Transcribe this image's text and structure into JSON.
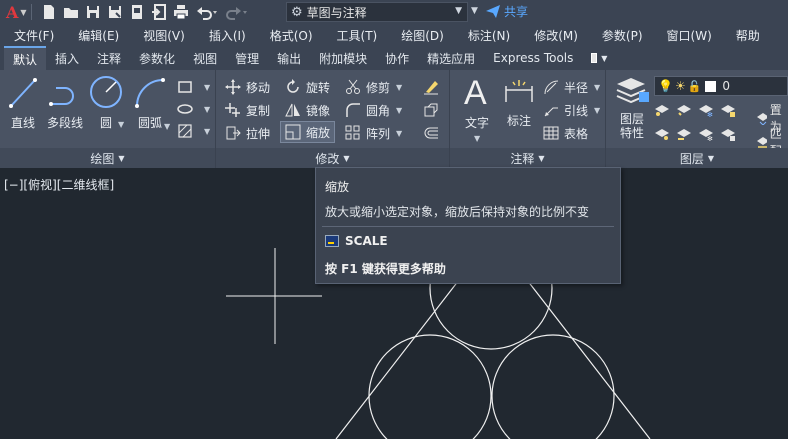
{
  "qbar": {
    "app_logo": "A",
    "workspace": "草图与注释",
    "share": "共享"
  },
  "menu": [
    "文件(F)",
    "编辑(E)",
    "视图(V)",
    "插入(I)",
    "格式(O)",
    "工具(T)",
    "绘图(D)",
    "标注(N)",
    "修改(M)",
    "参数(P)",
    "窗口(W)",
    "帮助"
  ],
  "tabs": [
    "默认",
    "插入",
    "注释",
    "参数化",
    "视图",
    "管理",
    "输出",
    "附加模块",
    "协作",
    "精选应用",
    "Express Tools"
  ],
  "active_tab": "默认",
  "draw_panel": {
    "title": "绘图",
    "line": "直线",
    "polyline": "多段线",
    "circle": "圆",
    "arc": "圆弧"
  },
  "modify_panel": {
    "title": "修改",
    "move": "移动",
    "rotate": "旋转",
    "trim": "修剪",
    "copy": "复制",
    "mirror": "镜像",
    "fillet": "圆角",
    "stretch": "拉伸",
    "scale": "缩放",
    "array": "阵列"
  },
  "annotation_panel": {
    "title": "注释",
    "text": "文字",
    "dimension": "标注",
    "radius": "半径",
    "leader": "引线",
    "table": "表格"
  },
  "layers_panel": {
    "title": "图层",
    "layer_props": "图层\n特性",
    "current_layer": "0",
    "set_current": "置为",
    "match": "匹配"
  },
  "viewport": {
    "label": "[−][俯视][二维线框]"
  },
  "tooltip": {
    "title": "缩放",
    "description": "放大或缩小选定对象，缩放后保持对象的比例不变",
    "command": "SCALE",
    "help": "按 F1 键获得更多帮助"
  },
  "colors": {
    "background": "#212830",
    "ribbon": "#4a5363",
    "accent": "#59a8ff",
    "logo_red": "#e0383e"
  }
}
